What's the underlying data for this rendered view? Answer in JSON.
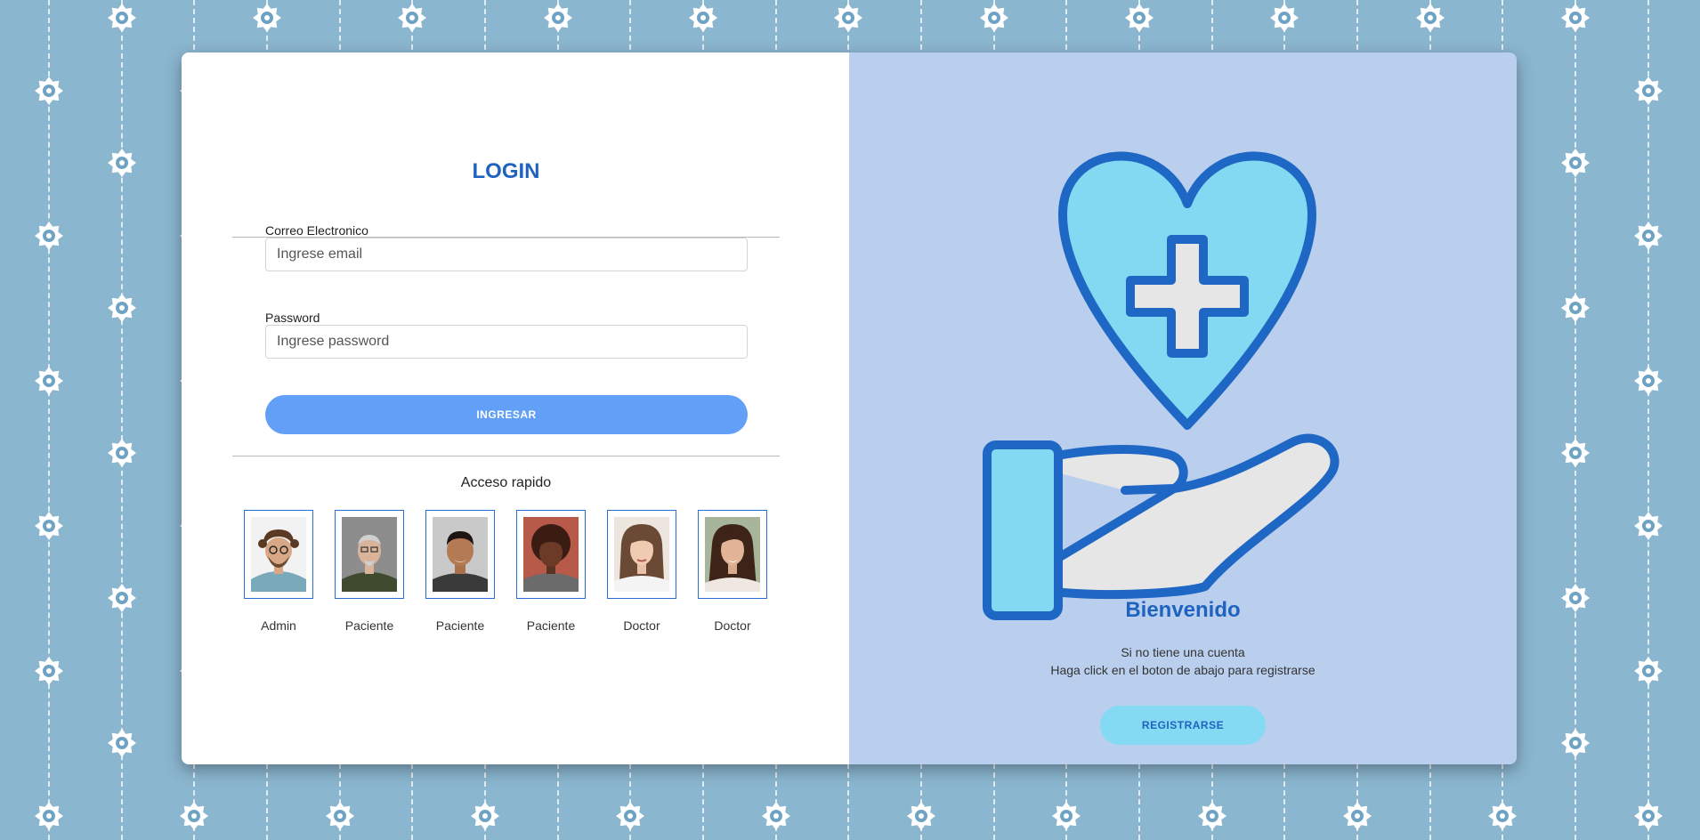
{
  "login": {
    "title": "LOGIN",
    "email_label": "Correo Electronico",
    "email_placeholder": "Ingrese email",
    "email_value": "",
    "password_label": "Password",
    "password_placeholder": "Ingrese password",
    "password_value": "",
    "submit_label": "INGRESAR"
  },
  "quick_access": {
    "title": "Acceso rapido",
    "users": [
      {
        "role": "Admin"
      },
      {
        "role": "Paciente"
      },
      {
        "role": "Paciente"
      },
      {
        "role": "Paciente"
      },
      {
        "role": "Doctor"
      },
      {
        "role": "Doctor"
      }
    ]
  },
  "welcome": {
    "title": "Bienvenido",
    "line1": "Si no tiene una cuenta",
    "line2": "Haga click en el boton de abajo para registrarse",
    "register_label": "REGISTRARSE",
    "illustration_icon": "heart-hand-care-icon"
  },
  "colors": {
    "background": "#8bb6d0",
    "primary_text": "#1f63c0",
    "login_button": "#62a0f8",
    "register_button": "#83daf2",
    "right_panel": "#bacfee"
  }
}
